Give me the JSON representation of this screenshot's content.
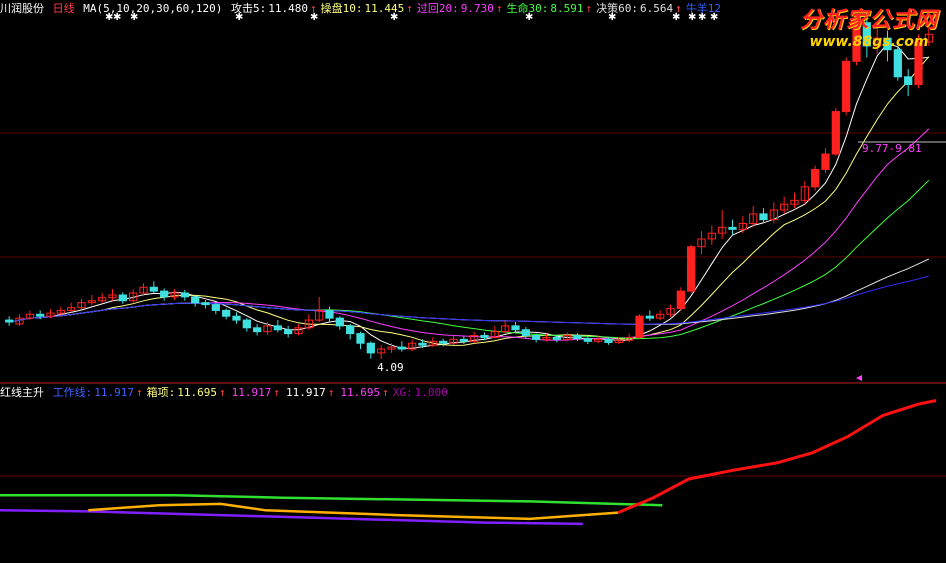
{
  "header": {
    "stock_name": "川润股份",
    "period": "日线",
    "ma_label": "MA(5,10,20,30,60,120)",
    "items": [
      {
        "label": "攻击5:",
        "value": "11.480",
        "arrow": "↑",
        "color": "#ffffff"
      },
      {
        "label": "操盘10:",
        "value": "11.445",
        "arrow": "↑",
        "color": "#ffff80"
      },
      {
        "label": "过回20:",
        "value": "9.730",
        "arrow": "↑",
        "color": "#ff40ff"
      },
      {
        "label": "生命30:",
        "value": "8.591",
        "arrow": "↑",
        "color": "#40ff40"
      },
      {
        "label": "决策60:",
        "value": "6.564",
        "arrow": "↑",
        "color": "#e0e0e0"
      },
      {
        "label": "牛羊12",
        "value": "",
        "arrow": "",
        "color": "#3060ff"
      }
    ]
  },
  "watermark": {
    "line1": "分析家公式网",
    "line2": "www.88gs.com"
  },
  "annotations": {
    "low_label": "4.09",
    "range_label": "9.77-9.81"
  },
  "sub_header": {
    "title": "红线主升",
    "items": [
      {
        "label": "工作线:",
        "value": "11.917",
        "arrow": "↑",
        "color": "#4060ff"
      },
      {
        "label": "箱项:",
        "value": "11.695",
        "arrow": "↑",
        "color": "#ffff80"
      },
      {
        "label": "",
        "value": "11.917",
        "arrow": "↑",
        "color": "#ff40ff"
      },
      {
        "label": "",
        "value": "11.917",
        "arrow": "↑",
        "color": "#ffffff"
      },
      {
        "label": "",
        "value": "11.695",
        "arrow": "↑",
        "color": "#ff40ff"
      },
      {
        "label": "XG:",
        "value": "1.000",
        "arrow": "",
        "color": "#a000a0"
      }
    ]
  },
  "chart_data": [
    {
      "type": "candlestick",
      "title": "川润股份 日线",
      "y_range": [
        3.6,
        13.0
      ],
      "candles": [
        [
          5.1,
          5.05,
          5.2,
          4.95
        ],
        [
          5.0,
          5.15,
          5.25,
          4.95
        ],
        [
          5.15,
          5.25,
          5.35,
          5.1
        ],
        [
          5.25,
          5.2,
          5.35,
          5.12
        ],
        [
          5.2,
          5.28,
          5.38,
          5.15
        ],
        [
          5.28,
          5.35,
          5.45,
          5.22
        ],
        [
          5.35,
          5.42,
          5.55,
          5.3
        ],
        [
          5.42,
          5.55,
          5.65,
          5.38
        ],
        [
          5.55,
          5.6,
          5.75,
          5.48
        ],
        [
          5.6,
          5.68,
          5.8,
          5.55
        ],
        [
          5.68,
          5.75,
          5.9,
          5.6
        ],
        [
          5.75,
          5.6,
          5.82,
          5.52
        ],
        [
          5.6,
          5.8,
          5.9,
          5.55
        ],
        [
          5.8,
          5.95,
          6.05,
          5.72
        ],
        [
          5.95,
          5.85,
          6.1,
          5.78
        ],
        [
          5.85,
          5.7,
          5.92,
          5.6
        ],
        [
          5.7,
          5.8,
          5.9,
          5.62
        ],
        [
          5.8,
          5.7,
          5.88,
          5.6
        ],
        [
          5.7,
          5.55,
          5.75,
          5.45
        ],
        [
          5.55,
          5.5,
          5.62,
          5.4
        ],
        [
          5.5,
          5.35,
          5.55,
          5.25
        ],
        [
          5.35,
          5.2,
          5.4,
          5.12
        ],
        [
          5.2,
          5.1,
          5.3,
          5.0
        ],
        [
          5.1,
          4.9,
          5.15,
          4.8
        ],
        [
          4.9,
          4.8,
          5.0,
          4.7
        ],
        [
          4.8,
          4.95,
          5.05,
          4.72
        ],
        [
          4.95,
          4.85,
          5.1,
          4.78
        ],
        [
          4.85,
          4.75,
          4.95,
          4.65
        ],
        [
          4.75,
          4.9,
          5.0,
          4.7
        ],
        [
          4.9,
          5.1,
          5.25,
          4.85
        ],
        [
          5.1,
          5.35,
          5.7,
          5.05
        ],
        [
          5.35,
          5.15,
          5.45,
          5.05
        ],
        [
          5.15,
          4.95,
          5.2,
          4.85
        ],
        [
          4.95,
          4.75,
          5.0,
          4.6
        ],
        [
          4.75,
          4.5,
          4.8,
          4.35
        ],
        [
          4.5,
          4.25,
          4.55,
          4.1
        ],
        [
          4.25,
          4.35,
          4.45,
          4.09
        ],
        [
          4.35,
          4.4,
          4.5,
          4.25
        ],
        [
          4.4,
          4.35,
          4.55,
          4.28
        ],
        [
          4.35,
          4.5,
          4.6,
          4.3
        ],
        [
          4.5,
          4.45,
          4.6,
          4.38
        ],
        [
          4.45,
          4.55,
          4.65,
          4.4
        ],
        [
          4.55,
          4.5,
          4.62,
          4.42
        ],
        [
          4.5,
          4.6,
          4.72,
          4.45
        ],
        [
          4.6,
          4.55,
          4.68,
          4.48
        ],
        [
          4.55,
          4.7,
          4.8,
          4.5
        ],
        [
          4.7,
          4.65,
          4.78,
          4.58
        ],
        [
          4.65,
          4.8,
          4.95,
          4.62
        ],
        [
          4.8,
          4.95,
          5.1,
          4.75
        ],
        [
          4.95,
          4.85,
          5.05,
          4.78
        ],
        [
          4.85,
          4.7,
          4.92,
          4.62
        ],
        [
          4.7,
          4.6,
          4.75,
          4.52
        ],
        [
          4.6,
          4.65,
          4.75,
          4.55
        ],
        [
          4.65,
          4.6,
          4.72,
          4.52
        ],
        [
          4.6,
          4.7,
          4.78,
          4.55
        ],
        [
          4.7,
          4.62,
          4.76,
          4.56
        ],
        [
          4.62,
          4.55,
          4.7,
          4.48
        ],
        [
          4.55,
          4.6,
          4.68,
          4.5
        ],
        [
          4.6,
          4.52,
          4.66,
          4.46
        ],
        [
          4.52,
          4.58,
          4.65,
          4.48
        ],
        [
          4.58,
          4.65,
          4.75,
          4.52
        ],
        [
          4.65,
          5.2,
          5.25,
          4.62
        ],
        [
          5.2,
          5.15,
          5.35,
          5.08
        ],
        [
          5.15,
          5.25,
          5.35,
          5.1
        ],
        [
          5.25,
          5.4,
          5.5,
          5.18
        ],
        [
          5.4,
          5.85,
          5.95,
          5.35
        ],
        [
          5.85,
          7.0,
          7.05,
          5.8
        ],
        [
          7.0,
          7.2,
          7.4,
          6.8
        ],
        [
          7.2,
          7.35,
          7.55,
          7.05
        ],
        [
          7.35,
          7.5,
          7.95,
          7.2
        ],
        [
          7.5,
          7.45,
          7.7,
          7.3
        ],
        [
          7.45,
          7.6,
          7.8,
          7.35
        ],
        [
          7.6,
          7.85,
          8.05,
          7.5
        ],
        [
          7.85,
          7.7,
          8.0,
          7.6
        ],
        [
          7.7,
          7.95,
          8.15,
          7.6
        ],
        [
          7.95,
          8.1,
          8.3,
          7.85
        ],
        [
          8.1,
          8.2,
          8.4,
          8.0
        ],
        [
          8.2,
          8.55,
          8.7,
          8.1
        ],
        [
          8.55,
          9.0,
          9.1,
          8.45
        ],
        [
          9.0,
          9.4,
          9.55,
          8.9
        ],
        [
          9.4,
          10.5,
          10.6,
          9.35
        ],
        [
          10.5,
          11.8,
          11.9,
          10.4
        ],
        [
          11.8,
          12.8,
          12.9,
          11.7
        ],
        [
          12.8,
          12.2,
          13.1,
          11.9
        ],
        [
          12.2,
          12.4,
          12.7,
          12.0
        ],
        [
          12.4,
          12.1,
          12.6,
          11.8
        ],
        [
          12.1,
          11.4,
          12.2,
          11.3
        ],
        [
          11.4,
          11.2,
          11.6,
          10.9
        ],
        [
          11.2,
          12.3,
          12.5,
          11.1
        ],
        [
          12.3,
          12.5,
          12.8,
          12.2
        ]
      ],
      "ma_periods": [
        5,
        10,
        20,
        30,
        60,
        120
      ],
      "ma_colors": [
        "#ffffff",
        "#ffff80",
        "#ff40ff",
        "#40ff40",
        "#e0e0e0",
        "#3030ff"
      ]
    },
    {
      "type": "line",
      "title": "红线主升",
      "y_range": [
        0,
        13
      ],
      "series": [
        {
          "color": "#30e030",
          "points": [
            [
              0,
              5.2
            ],
            [
              20,
              5.2
            ],
            [
              32,
              5.0
            ],
            [
              60,
              4.7
            ],
            [
              75,
              4.4
            ]
          ]
        },
        {
          "color": "#8020ff",
          "points": [
            [
              0,
              4.0
            ],
            [
              10,
              3.9
            ],
            [
              25,
              3.6
            ],
            [
              40,
              3.3
            ],
            [
              55,
              3.0
            ],
            [
              66,
              2.9
            ]
          ]
        },
        {
          "color": "#ffb000",
          "points": [
            [
              10,
              4.0
            ],
            [
              18,
              4.4
            ],
            [
              25,
              4.5
            ],
            [
              30,
              4.0
            ],
            [
              45,
              3.6
            ],
            [
              60,
              3.3
            ],
            [
              70,
              3.8
            ]
          ]
        },
        {
          "color": "#ff1010",
          "points": [
            [
              70,
              3.8
            ],
            [
              74,
              5.0
            ],
            [
              78,
              6.5
            ],
            [
              83,
              7.2
            ],
            [
              88,
              7.8
            ],
            [
              92,
              8.6
            ],
            [
              96,
              9.9
            ],
            [
              100,
              11.6
            ],
            [
              104,
              12.5
            ],
            [
              106,
              12.8
            ]
          ]
        }
      ]
    }
  ]
}
